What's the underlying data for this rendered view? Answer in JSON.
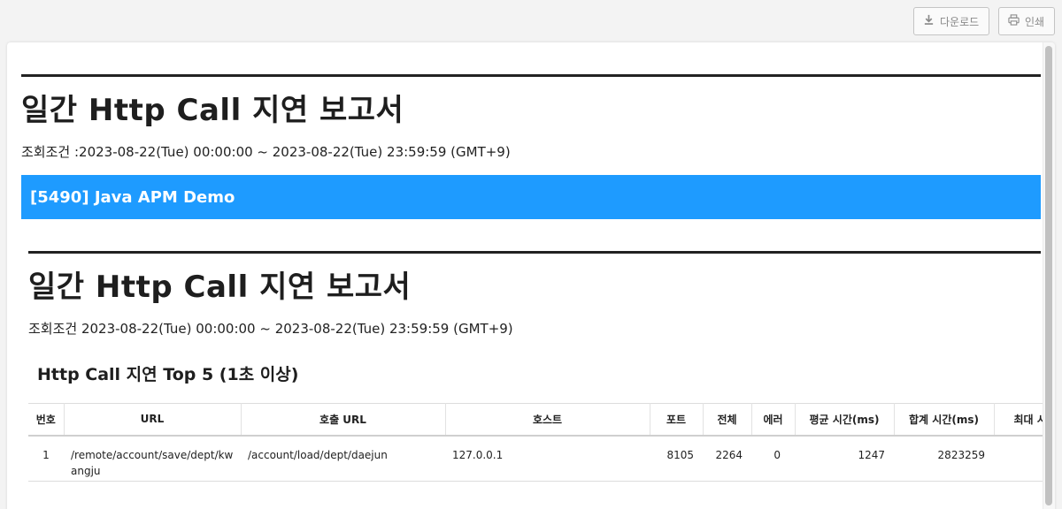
{
  "toolbar": {
    "download_label": "다운로드",
    "print_label": "인쇄"
  },
  "report": {
    "title": "일간 Http Call 지연 보고서",
    "condition": "조회조건 :2023-08-22(Tue) 00:00:00 ~ 2023-08-22(Tue) 23:59:59 (GMT+9)",
    "project_bar": "[5490] Java APM Demo"
  },
  "section": {
    "title": "일간 Http Call 지연 보고서",
    "condition": "조회조건 2023-08-22(Tue) 00:00:00 ~ 2023-08-22(Tue) 23:59:59 (GMT+9)",
    "subtitle": "Http Call 지연 Top 5 (1초 이상)",
    "table": {
      "headers": [
        "번호",
        "URL",
        "호출 URL",
        "호스트",
        "포트",
        "전체",
        "에러",
        "평균 시간(ms)",
        "합계 시간(ms)",
        "최대 시"
      ],
      "rows": [
        [
          "1",
          "/remote/account/save/dept/kwangju",
          "/account/load/dept/daejun",
          "127.0.0.1",
          "8105",
          "2264",
          "0",
          "1247",
          "2823259",
          ""
        ]
      ]
    }
  },
  "colors": {
    "accent": "#1e9bff",
    "rule": "#222222",
    "background": "#f3f3f3"
  }
}
